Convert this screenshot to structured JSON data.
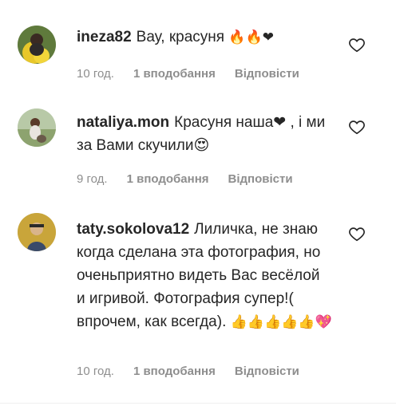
{
  "comments": [
    {
      "username": "ineza82",
      "text": "Вау, красуня",
      "emoji": "🔥🔥❤",
      "time": "10 год.",
      "likes": "1 вподобання",
      "reply": "Відповісти"
    },
    {
      "username": "nataliya.mon",
      "text": "Красуня наша❤ , і ми за Вами скучили😍",
      "emoji": "",
      "time": "9 год.",
      "likes": "1 вподобання",
      "reply": "Відповісти"
    },
    {
      "username": "taty.sokolova12",
      "text": "Лиличка, не знаю когда сделана эта фотография, но оченьприятно видеть Вас весёлой и игривой. Фотография супер!( впрочем, как всегда).",
      "emoji": "👍👍👍👍👍💖",
      "time": "10 год.",
      "likes": "1 вподобання",
      "reply": "Відповісти"
    }
  ]
}
